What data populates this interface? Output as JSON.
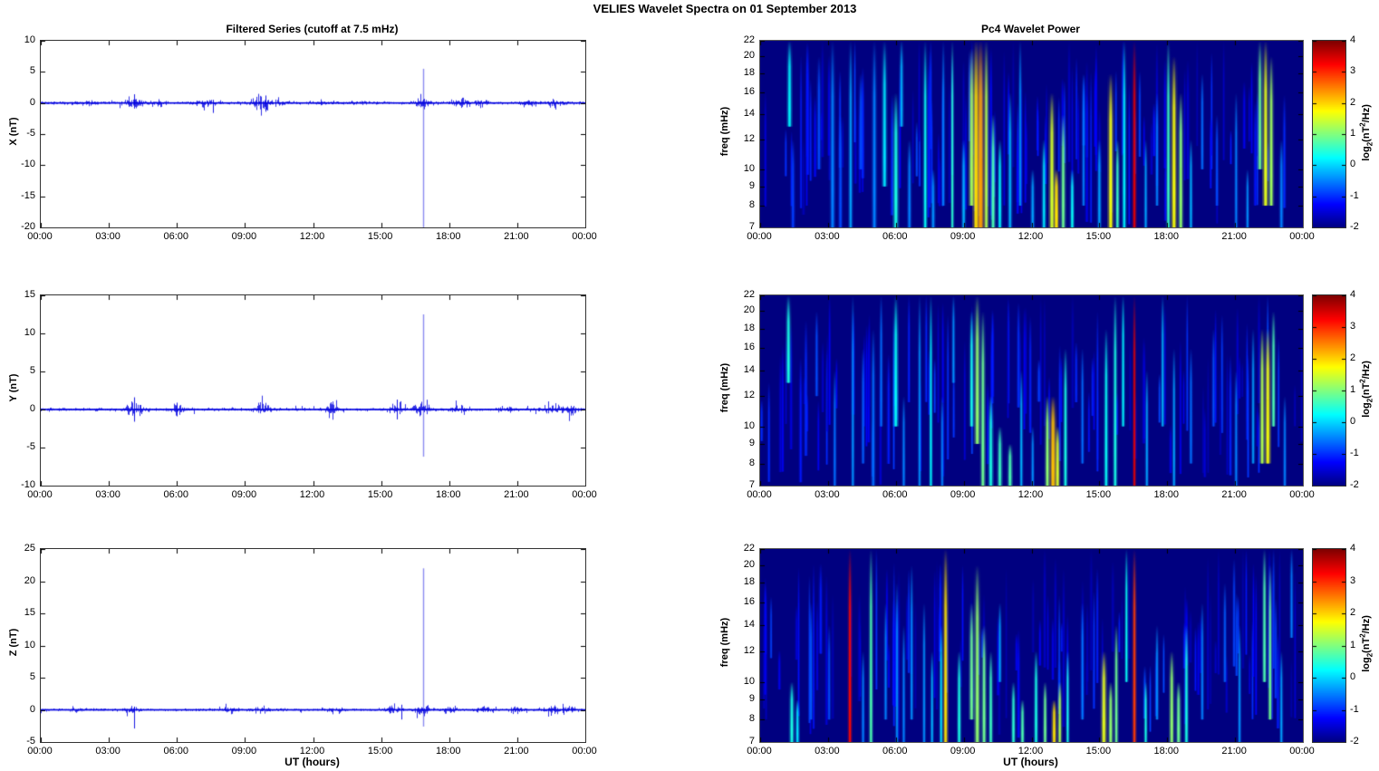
{
  "figure": {
    "title": "VELIES Wavelet Spectra on 01 September 2013"
  },
  "shared": {
    "time_ticks": [
      "00:00",
      "03:00",
      "06:00",
      "09:00",
      "12:00",
      "15:00",
      "18:00",
      "21:00",
      "00:00"
    ],
    "x_range_hours": [
      0,
      24
    ],
    "freq_ticks": [
      22,
      20,
      18,
      16,
      14,
      12,
      10,
      9,
      8,
      7
    ],
    "freq_range_mhz": [
      7,
      22
    ],
    "line_color": "#0000DF",
    "colorbar": {
      "ticks": [
        4,
        3,
        2,
        1,
        0,
        -1,
        -2
      ],
      "range": [
        -2,
        4
      ],
      "label_parts": {
        "prefix": "log",
        "sub": "2",
        "mid": "(nT",
        "sup": "2",
        "suffix": "/Hz)"
      }
    }
  },
  "chart_data": [
    {
      "type": "line",
      "title": "Filtered Series (cutoff at 7.5 mHz)",
      "ylabel": "X (nT)",
      "ylim": [
        -20,
        10
      ],
      "yticks": [
        10,
        5,
        0,
        -5,
        -10,
        -15,
        -20
      ],
      "baseline": 0,
      "noise_std": 0.12,
      "seed": 11,
      "noise_bursts": [
        [
          2.0,
          0.15
        ],
        [
          4.1,
          0.5
        ],
        [
          5.2,
          0.2
        ],
        [
          7.3,
          0.3
        ],
        [
          9.6,
          0.45
        ],
        [
          9.9,
          0.4
        ],
        [
          10.3,
          0.3
        ],
        [
          12.3,
          0.2
        ],
        [
          14.0,
          0.2
        ],
        [
          16.8,
          0.5
        ],
        [
          18.5,
          0.35
        ],
        [
          19.3,
          0.2
        ],
        [
          21.5,
          0.3
        ],
        [
          22.6,
          0.35
        ]
      ],
      "spikes": [
        [
          16.85,
          5.5,
          -20
        ],
        [
          4.1,
          1.4,
          -0.9
        ],
        [
          7.6,
          0.5,
          -1.6
        ],
        [
          9.9,
          1.2,
          -1.2
        ]
      ]
    },
    {
      "type": "heatmap",
      "title": "Pc4 Wavelet Power",
      "ylabel": "freq (mHz)",
      "event_fields": [
        "hour",
        "freq_lo_mHz",
        "freq_hi_mHz",
        "log2_power",
        "width_min"
      ],
      "texture_count": 115,
      "seed": 21,
      "events": [
        [
          1.3,
          13,
          22,
          0.2,
          6
        ],
        [
          1.45,
          7,
          12,
          -0.9,
          5
        ],
        [
          2.6,
          10,
          20,
          -0.8,
          5
        ],
        [
          3.2,
          7,
          22,
          -0.5,
          6
        ],
        [
          3.55,
          7,
          14,
          -0.8,
          5
        ],
        [
          4.0,
          7,
          22,
          -0.3,
          5
        ],
        [
          4.45,
          10,
          18,
          -0.8,
          5
        ],
        [
          5.05,
          7,
          22,
          -0.5,
          6
        ],
        [
          5.5,
          9,
          22,
          0.1,
          6
        ],
        [
          6.0,
          7,
          16,
          0.4,
          7
        ],
        [
          6.25,
          13,
          22,
          -0.2,
          5
        ],
        [
          6.6,
          7,
          12,
          -0.5,
          5
        ],
        [
          7.3,
          7,
          22,
          0.3,
          5
        ],
        [
          7.65,
          7,
          10,
          -0.4,
          5
        ],
        [
          8.1,
          8,
          22,
          -0.5,
          4
        ],
        [
          8.5,
          7,
          22,
          0.5,
          4
        ],
        [
          9.0,
          7,
          12,
          -0.2,
          5
        ],
        [
          9.35,
          8,
          21,
          1.2,
          7
        ],
        [
          9.55,
          7,
          22,
          1.9,
          8
        ],
        [
          9.75,
          7,
          22,
          2.3,
          9
        ],
        [
          10.0,
          7,
          22,
          1.3,
          6
        ],
        [
          10.3,
          7,
          14,
          0.7,
          6
        ],
        [
          10.6,
          7,
          12,
          0.2,
          5
        ],
        [
          11.05,
          7,
          16,
          -0.2,
          5
        ],
        [
          11.5,
          8,
          22,
          -0.4,
          4
        ],
        [
          12.05,
          7,
          10,
          -0.3,
          5
        ],
        [
          12.55,
          7,
          12,
          0.1,
          5
        ],
        [
          12.9,
          7,
          16,
          1.5,
          7
        ],
        [
          13.1,
          7,
          10,
          1.9,
          7
        ],
        [
          13.4,
          7,
          14,
          0.9,
          6
        ],
        [
          13.8,
          7,
          10,
          0.3,
          5
        ],
        [
          14.3,
          8,
          18,
          -0.5,
          4
        ],
        [
          15.0,
          7,
          12,
          -0.3,
          5
        ],
        [
          15.5,
          7,
          18,
          1.7,
          7
        ],
        [
          15.8,
          7,
          12,
          0.6,
          5
        ],
        [
          16.1,
          7,
          22,
          0.2,
          5
        ],
        [
          16.55,
          7,
          22,
          3.4,
          5
        ],
        [
          17.05,
          7,
          12,
          -0.3,
          4
        ],
        [
          17.55,
          8,
          16,
          -0.5,
          4
        ],
        [
          18.05,
          7,
          22,
          0.6,
          5
        ],
        [
          18.3,
          7,
          20,
          1.7,
          7
        ],
        [
          18.6,
          7,
          16,
          1.1,
          6
        ],
        [
          19.05,
          7,
          12,
          -0.2,
          4
        ],
        [
          19.55,
          10,
          18,
          -0.6,
          4
        ],
        [
          20.2,
          8,
          14,
          -0.8,
          4
        ],
        [
          21.05,
          7,
          16,
          -0.5,
          4
        ],
        [
          21.55,
          7,
          10,
          -0.4,
          4
        ],
        [
          22.1,
          10,
          22,
          0.9,
          6
        ],
        [
          22.35,
          8,
          22,
          1.6,
          7
        ],
        [
          22.6,
          8,
          20,
          1.2,
          6
        ],
        [
          23.05,
          7,
          12,
          -0.5,
          5
        ]
      ]
    },
    {
      "type": "line",
      "ylabel": "Y (nT)",
      "ylim": [
        -10,
        15
      ],
      "yticks": [
        15,
        10,
        5,
        0,
        -5,
        -10
      ],
      "baseline": 0,
      "noise_std": 0.1,
      "seed": 12,
      "noise_bursts": [
        [
          4.1,
          0.6
        ],
        [
          6.0,
          0.25
        ],
        [
          9.7,
          0.3
        ],
        [
          12.9,
          0.35
        ],
        [
          15.7,
          0.3
        ],
        [
          16.8,
          0.5
        ],
        [
          18.4,
          0.25
        ],
        [
          20.5,
          0.2
        ],
        [
          22.5,
          0.4
        ],
        [
          23.3,
          0.3
        ]
      ],
      "spikes": [
        [
          16.85,
          12.5,
          -6.2
        ],
        [
          4.1,
          1.6,
          -1.6
        ],
        [
          6.0,
          0.9,
          -0.9
        ],
        [
          15.7,
          1.3,
          -1.3
        ]
      ]
    },
    {
      "type": "heatmap",
      "ylabel": "freq (mHz)",
      "event_fields": [
        "hour",
        "freq_lo_mHz",
        "freq_hi_mHz",
        "log2_power",
        "width_min"
      ],
      "texture_count": 95,
      "seed": 22,
      "events": [
        [
          1.25,
          13,
          22,
          0.4,
          6
        ],
        [
          2.5,
          12,
          20,
          -0.8,
          4
        ],
        [
          3.3,
          7,
          14,
          -0.6,
          4
        ],
        [
          4.1,
          7,
          22,
          -0.4,
          4
        ],
        [
          4.55,
          8,
          16,
          -0.7,
          4
        ],
        [
          5.0,
          7,
          18,
          -0.6,
          5
        ],
        [
          5.35,
          10,
          22,
          -0.6,
          4
        ],
        [
          6.0,
          10,
          22,
          0.3,
          6
        ],
        [
          6.35,
          7,
          12,
          -0.5,
          4
        ],
        [
          7.05,
          7,
          22,
          -0.4,
          4
        ],
        [
          7.55,
          7,
          22,
          0.2,
          4
        ],
        [
          8.05,
          7,
          12,
          -0.5,
          4
        ],
        [
          8.55,
          13,
          22,
          -0.4,
          4
        ],
        [
          9.35,
          10,
          20,
          0.4,
          5
        ],
        [
          9.6,
          9,
          22,
          1.1,
          7
        ],
        [
          9.85,
          7,
          20,
          0.9,
          6
        ],
        [
          10.2,
          7,
          12,
          0.4,
          6
        ],
        [
          10.6,
          7,
          10,
          0.6,
          6
        ],
        [
          11.05,
          7,
          9,
          0.7,
          6
        ],
        [
          11.55,
          7,
          14,
          -0.2,
          4
        ],
        [
          12.05,
          7,
          10,
          -0.4,
          4
        ],
        [
          12.7,
          7,
          12,
          1.1,
          6
        ],
        [
          12.95,
          7,
          12,
          2.1,
          8
        ],
        [
          13.15,
          7,
          10,
          1.5,
          6
        ],
        [
          13.5,
          7,
          16,
          0.4,
          5
        ],
        [
          14.25,
          8,
          16,
          -0.6,
          4
        ],
        [
          15.3,
          7,
          18,
          0.3,
          5
        ],
        [
          15.7,
          7,
          22,
          0.4,
          5
        ],
        [
          16.05,
          10,
          22,
          0.2,
          4
        ],
        [
          16.55,
          7,
          22,
          3.4,
          4
        ],
        [
          17.1,
          7,
          14,
          -0.3,
          4
        ],
        [
          17.8,
          10,
          22,
          -0.2,
          4
        ],
        [
          18.3,
          7,
          16,
          -0.3,
          4
        ],
        [
          19.05,
          8,
          16,
          -0.6,
          4
        ],
        [
          20.05,
          10,
          18,
          -0.8,
          4
        ],
        [
          21.05,
          7,
          14,
          -0.5,
          4
        ],
        [
          21.8,
          8,
          18,
          -0.3,
          4
        ],
        [
          22.2,
          8,
          18,
          1.3,
          6
        ],
        [
          22.45,
          8,
          18,
          1.7,
          7
        ],
        [
          22.7,
          10,
          20,
          0.7,
          5
        ],
        [
          23.2,
          7,
          12,
          -0.5,
          4
        ]
      ]
    },
    {
      "type": "line",
      "ylabel": "Z (nT)",
      "ylim": [
        -5,
        25
      ],
      "yticks": [
        25,
        20,
        15,
        10,
        5,
        0,
        -5
      ],
      "xlabel": "UT (hours)",
      "baseline": 0,
      "noise_std": 0.1,
      "seed": 13,
      "noise_bursts": [
        [
          1.5,
          0.15
        ],
        [
          4.1,
          0.3
        ],
        [
          8.3,
          0.2
        ],
        [
          9.7,
          0.25
        ],
        [
          13.0,
          0.2
        ],
        [
          15.5,
          0.25
        ],
        [
          16.8,
          0.4
        ],
        [
          18.0,
          0.3
        ],
        [
          19.5,
          0.3
        ],
        [
          21.0,
          0.25
        ],
        [
          22.5,
          0.35
        ],
        [
          23.3,
          0.3
        ]
      ],
      "spikes": [
        [
          16.85,
          22,
          -2.6
        ],
        [
          4.1,
          0.5,
          -2.9
        ],
        [
          15.9,
          0.8,
          -1.5
        ]
      ]
    },
    {
      "type": "heatmap",
      "ylabel": "freq (mHz)",
      "xlabel": "UT (hours)",
      "event_fields": [
        "hour",
        "freq_lo_mHz",
        "freq_hi_mHz",
        "log2_power",
        "width_min"
      ],
      "texture_count": 105,
      "seed": 23,
      "events": [
        [
          1.4,
          7,
          10,
          0.4,
          6
        ],
        [
          1.65,
          7,
          9,
          0.1,
          5
        ],
        [
          2.25,
          8,
          16,
          -0.7,
          4
        ],
        [
          3.05,
          8,
          14,
          -0.8,
          4
        ],
        [
          3.97,
          7,
          22,
          3.2,
          5
        ],
        [
          4.55,
          7,
          12,
          -0.5,
          4
        ],
        [
          4.9,
          7,
          22,
          0.7,
          5
        ],
        [
          5.55,
          8,
          16,
          -0.5,
          4
        ],
        [
          6.05,
          7,
          18,
          -0.4,
          4
        ],
        [
          6.35,
          7,
          14,
          -0.5,
          4
        ],
        [
          6.7,
          8,
          20,
          -0.4,
          4
        ],
        [
          7.25,
          7,
          16,
          -0.4,
          4
        ],
        [
          7.6,
          7,
          12,
          -0.2,
          4
        ],
        [
          8.0,
          7,
          14,
          0.1,
          4
        ],
        [
          8.2,
          7,
          22,
          1.9,
          6
        ],
        [
          8.8,
          7,
          12,
          0.4,
          5
        ],
        [
          9.35,
          8,
          16,
          0.9,
          6
        ],
        [
          9.6,
          7,
          20,
          1.1,
          7
        ],
        [
          9.9,
          7,
          14,
          0.9,
          6
        ],
        [
          10.2,
          7,
          12,
          0.6,
          5
        ],
        [
          10.6,
          10,
          16,
          -0.3,
          4
        ],
        [
          11.2,
          7,
          10,
          0.5,
          5
        ],
        [
          11.6,
          7,
          9,
          0.7,
          5
        ],
        [
          12.2,
          7,
          12,
          0.4,
          5
        ],
        [
          12.6,
          7,
          10,
          0.9,
          5
        ],
        [
          13.0,
          7,
          9,
          1.9,
          6
        ],
        [
          13.25,
          7,
          10,
          1.3,
          5
        ],
        [
          13.6,
          7,
          12,
          0.4,
          4
        ],
        [
          14.25,
          8,
          16,
          -0.5,
          4
        ],
        [
          15.2,
          7,
          12,
          1.6,
          7
        ],
        [
          15.5,
          7,
          10,
          1.1,
          6
        ],
        [
          15.75,
          7,
          14,
          0.9,
          5
        ],
        [
          16.2,
          10,
          22,
          0.3,
          4
        ],
        [
          16.55,
          7,
          22,
          2.9,
          5
        ],
        [
          17.05,
          7,
          10,
          0.4,
          4
        ],
        [
          17.55,
          8,
          14,
          -0.4,
          4
        ],
        [
          18.2,
          7,
          12,
          1.1,
          6
        ],
        [
          18.5,
          7,
          10,
          0.9,
          6
        ],
        [
          18.85,
          7,
          14,
          0.4,
          5
        ],
        [
          19.55,
          8,
          16,
          -0.5,
          4
        ],
        [
          20.55,
          10,
          18,
          -0.7,
          4
        ],
        [
          21.2,
          7,
          14,
          -0.4,
          4
        ],
        [
          22.3,
          10,
          22,
          0.7,
          5
        ],
        [
          22.55,
          8,
          20,
          0.9,
          5
        ],
        [
          23.05,
          7,
          12,
          -0.3,
          4
        ],
        [
          23.5,
          13,
          22,
          -0.5,
          4
        ]
      ]
    }
  ]
}
